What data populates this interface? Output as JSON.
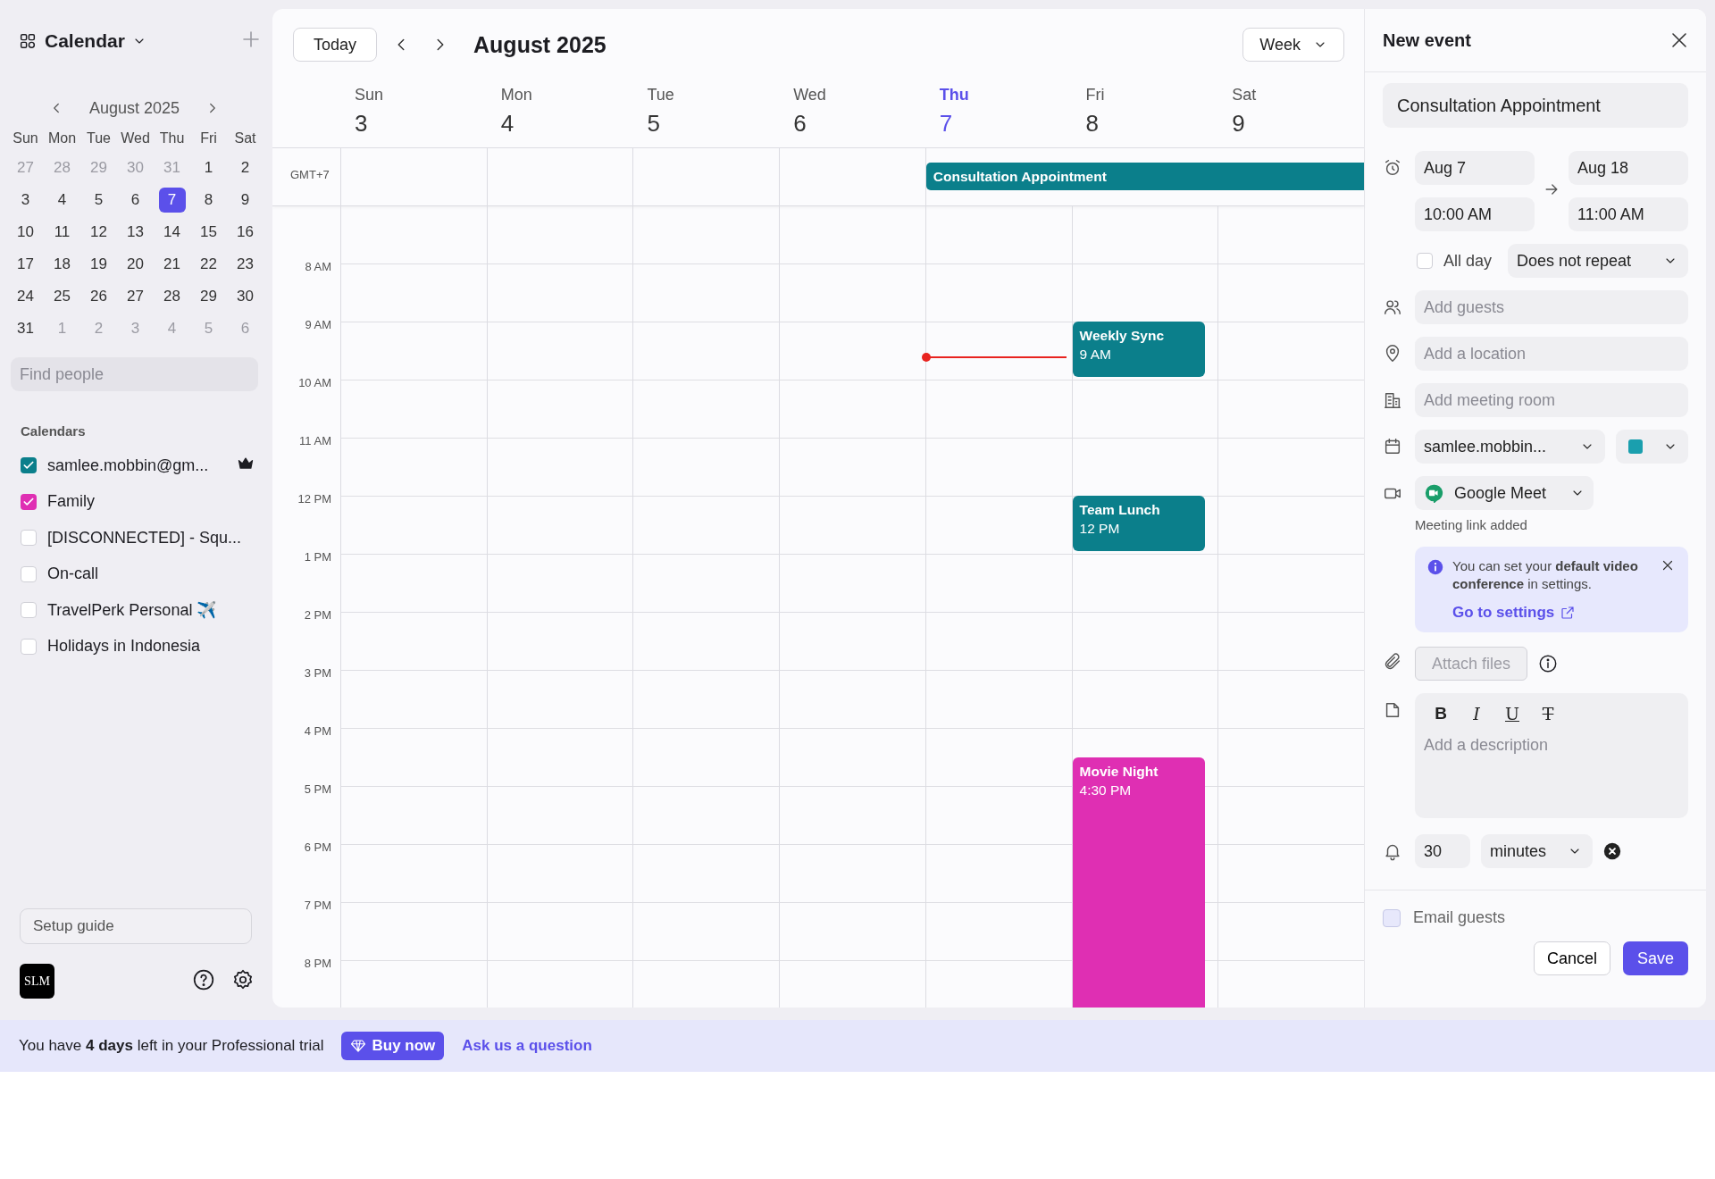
{
  "sidebar": {
    "title": "Calendar",
    "mini_calendar": {
      "title": "August 2025",
      "weekdays": [
        "Sun",
        "Mon",
        "Tue",
        "Wed",
        "Thu",
        "Fri",
        "Sat"
      ],
      "days": [
        {
          "label": "27",
          "outside": true,
          "selected": false
        },
        {
          "label": "28",
          "outside": true,
          "selected": false
        },
        {
          "label": "29",
          "outside": true,
          "selected": false
        },
        {
          "label": "30",
          "outside": true,
          "selected": false
        },
        {
          "label": "31",
          "outside": true,
          "selected": false
        },
        {
          "label": "1",
          "outside": false,
          "selected": false
        },
        {
          "label": "2",
          "outside": false,
          "selected": false
        },
        {
          "label": "3",
          "outside": false,
          "selected": false
        },
        {
          "label": "4",
          "outside": false,
          "selected": false
        },
        {
          "label": "5",
          "outside": false,
          "selected": false
        },
        {
          "label": "6",
          "outside": false,
          "selected": false
        },
        {
          "label": "7",
          "outside": false,
          "selected": true
        },
        {
          "label": "8",
          "outside": false,
          "selected": false
        },
        {
          "label": "9",
          "outside": false,
          "selected": false
        },
        {
          "label": "10",
          "outside": false,
          "selected": false
        },
        {
          "label": "11",
          "outside": false,
          "selected": false
        },
        {
          "label": "12",
          "outside": false,
          "selected": false
        },
        {
          "label": "13",
          "outside": false,
          "selected": false
        },
        {
          "label": "14",
          "outside": false,
          "selected": false
        },
        {
          "label": "15",
          "outside": false,
          "selected": false
        },
        {
          "label": "16",
          "outside": false,
          "selected": false
        },
        {
          "label": "17",
          "outside": false,
          "selected": false
        },
        {
          "label": "18",
          "outside": false,
          "selected": false
        },
        {
          "label": "19",
          "outside": false,
          "selected": false
        },
        {
          "label": "20",
          "outside": false,
          "selected": false
        },
        {
          "label": "21",
          "outside": false,
          "selected": false
        },
        {
          "label": "22",
          "outside": false,
          "selected": false
        },
        {
          "label": "23",
          "outside": false,
          "selected": false
        },
        {
          "label": "24",
          "outside": false,
          "selected": false
        },
        {
          "label": "25",
          "outside": false,
          "selected": false
        },
        {
          "label": "26",
          "outside": false,
          "selected": false
        },
        {
          "label": "27",
          "outside": false,
          "selected": false
        },
        {
          "label": "28",
          "outside": false,
          "selected": false
        },
        {
          "label": "29",
          "outside": false,
          "selected": false
        },
        {
          "label": "30",
          "outside": false,
          "selected": false
        },
        {
          "label": "31",
          "outside": false,
          "selected": false
        },
        {
          "label": "1",
          "outside": true,
          "selected": false
        },
        {
          "label": "2",
          "outside": true,
          "selected": false
        },
        {
          "label": "3",
          "outside": true,
          "selected": false
        },
        {
          "label": "4",
          "outside": true,
          "selected": false
        },
        {
          "label": "5",
          "outside": true,
          "selected": false
        },
        {
          "label": "6",
          "outside": true,
          "selected": false
        }
      ]
    },
    "search": {
      "placeholder": "Find people"
    },
    "calendars": {
      "heading": "Calendars",
      "items": [
        {
          "label": "samlee.mobbin@gm...",
          "checked": true,
          "color": "#0b7f8b",
          "owner": true
        },
        {
          "label": "Family",
          "checked": true,
          "color": "#df2fb3",
          "owner": false
        },
        {
          "label": "[DISCONNECTED] - Squ...",
          "checked": false,
          "owner": false
        },
        {
          "label": "On-call",
          "checked": false,
          "owner": false
        },
        {
          "label": "TravelPerk Personal ✈️",
          "checked": false,
          "owner": false
        },
        {
          "label": "Holidays in Indonesia",
          "checked": false,
          "owner": false
        }
      ]
    },
    "setup_guide": "Setup guide",
    "avatar": "SLM"
  },
  "calendar": {
    "today": "Today",
    "title": "August 2025",
    "view": "Week",
    "timezone": "GMT+7",
    "days": [
      {
        "name": "Sun",
        "date": "3",
        "selected": false
      },
      {
        "name": "Mon",
        "date": "4",
        "selected": false
      },
      {
        "name": "Tue",
        "date": "5",
        "selected": false
      },
      {
        "name": "Wed",
        "date": "6",
        "selected": false
      },
      {
        "name": "Thu",
        "date": "7",
        "selected": true,
        "now_line": true,
        "all_day": [
          {
            "title": "Consultation Appointment",
            "color": "#0b7f8b",
            "continues": true
          }
        ]
      },
      {
        "name": "Fri",
        "date": "8",
        "selected": false,
        "events": [
          {
            "title": "Weekly Sync",
            "time": "9 AM",
            "color": "#0b7f8b",
            "continues": false
          },
          {
            "title": "Team Lunch",
            "time": "12 PM",
            "color": "#0b7f8b",
            "continues": false
          },
          {
            "title": "Movie Night",
            "time": "4:30 PM",
            "color": "#df2fb3",
            "continues": true
          }
        ]
      },
      {
        "name": "Sat",
        "date": "9",
        "selected": false
      }
    ],
    "hours": [
      "8 AM",
      "9 AM",
      "10 AM",
      "11 AM",
      "12 PM",
      "1 PM",
      "2 PM",
      "3 PM",
      "4 PM",
      "5 PM",
      "6 PM",
      "7 PM",
      "8 PM"
    ]
  },
  "new_event": {
    "heading": "New event",
    "title_value": "Consultation Appointment",
    "start_date": "Aug 7",
    "start_time": "10:00 AM",
    "end_date": "Aug 18",
    "end_time": "11:00 AM",
    "all_day": {
      "label": "All day",
      "checked": false
    },
    "repeat": "Does not repeat",
    "guests_placeholder": "Add guests",
    "location_placeholder": "Add a location",
    "room_placeholder": "Add meeting room",
    "calendar": "samlee.mobbin...",
    "color": "#1a9fae",
    "conference": "Google Meet",
    "conference_note": "Meeting link added",
    "tip": {
      "text": "You can set your **default video conference** in settings.",
      "link": "Go to settings"
    },
    "attach": {
      "label": "Attach files",
      "disabled": true
    },
    "formatting": [
      {
        "kind": "bold",
        "label": "B"
      },
      {
        "kind": "italic",
        "label": "I"
      },
      {
        "kind": "underline",
        "label": "U"
      },
      {
        "kind": "clear",
        "label": "T"
      }
    ],
    "description_placeholder": "Add a description",
    "reminder_value": "30",
    "reminder_unit": "minutes",
    "email_guests": {
      "label": "Email guests",
      "checked": false
    },
    "buttons": [
      "Cancel",
      "Save"
    ]
  },
  "trial_bar": {
    "text": "You have **4 days** left in your Professional trial",
    "buy": "Buy now",
    "ask": "Ask us a question"
  }
}
